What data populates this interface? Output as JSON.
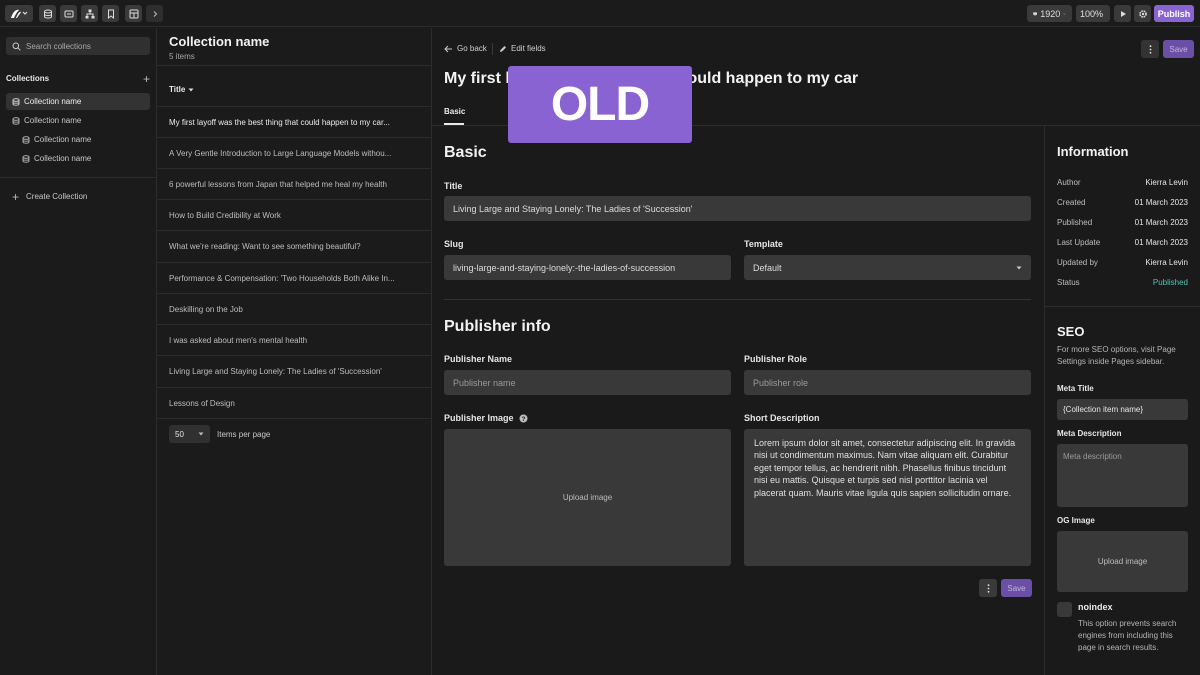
{
  "toolbar": {
    "resolution": "1920",
    "zoom": "100%",
    "publish_label": "Publish"
  },
  "sidebar": {
    "search_placeholder": "Search collections",
    "section_title": "Collections",
    "items": [
      {
        "label": "Collection name"
      },
      {
        "label": "Collection name"
      },
      {
        "label": "Collection name"
      },
      {
        "label": "Collection name"
      }
    ],
    "create_label": "Create Collection"
  },
  "list": {
    "title": "Collection name",
    "subtitle": "5 items",
    "column_header": "Title",
    "rows": [
      "My first layoff was the best thing that could happen to my car...",
      "A Very Gentle Introduction to Large Language Models withou...",
      "6 powerful lessons from Japan that helped me heal my health",
      "How to Build Credibility at Work",
      "What we're reading: Want to see something beautiful?",
      "Performance & Compensation: 'Two Households Both Alike In...",
      "Deskilling on the Job",
      "I was asked about men's mental health",
      "Living Large and Staying Lonely: The Ladies of 'Succession'",
      "Lessons of Design"
    ],
    "per_page_value": "50",
    "per_page_label": "Items per page"
  },
  "editor": {
    "go_back": "Go back",
    "edit_fields": "Edit fields",
    "save_label": "Save",
    "title_left": "My first l",
    "title_right": "that could happen to my car",
    "overlay_badge": "OLD",
    "tab_basic": "Basic",
    "basic_heading": "Basic",
    "title_label": "Title",
    "title_value": "Living Large and Staying Lonely: The Ladies of 'Succession'",
    "slug_label": "Slug",
    "slug_value": "living-large-and-staying-lonely:-the-ladies-of-succession",
    "template_label": "Template",
    "template_value": "Default",
    "publisher_heading": "Publisher info",
    "publisher_name_label": "Publisher Name",
    "publisher_name_placeholder": "Publisher name",
    "publisher_role_label": "Publisher Role",
    "publisher_role_placeholder": "Publisher role",
    "publisher_image_label": "Publisher Image",
    "upload_label": "Upload image",
    "short_desc_label": "Short Description",
    "short_desc_value": "Lorem ipsum dolor sit amet, consectetur adipiscing elit. In gravida nisi ut condimentum maximus. Nam vitae aliquam elit. Curabitur eget tempor tellus, ac hendrerit nibh. Phasellus finibus tincidunt nisi eu mattis. Quisque et turpis sed nisl porttitor lacinia vel placerat quam. Mauris vitae ligula quis sapien sollicitudin ornare."
  },
  "info": {
    "title": "Information",
    "rows": [
      {
        "key": "Author",
        "value": "Kierra Levin"
      },
      {
        "key": "Created",
        "value": "01 March 2023"
      },
      {
        "key": "Published",
        "value": "01 March 2023"
      },
      {
        "key": "Last Update",
        "value": "01 March 2023"
      },
      {
        "key": "Updated by",
        "value": "Kierra Levin"
      },
      {
        "key": "Status",
        "value": "Published"
      }
    ],
    "status_color": "#4fc3b4"
  },
  "seo": {
    "title": "SEO",
    "description": "For more SEO options, visit Page Settings inside Pages sidebar.",
    "meta_title_label": "Meta Title",
    "meta_title_value": "{Collection item name}",
    "meta_desc_label": "Meta Description",
    "meta_desc_placeholder": "Meta description",
    "og_image_label": "OG Image",
    "og_upload_label": "Upload image",
    "noindex_label": "noindex",
    "noindex_desc": "This option prevents search engines from including this page in search results."
  },
  "colors": {
    "accent": "#8a63d2",
    "save_disabled": "#6b4ea6"
  }
}
